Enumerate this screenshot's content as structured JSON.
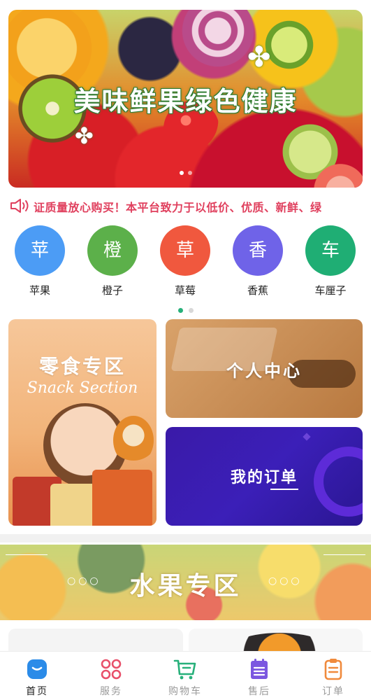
{
  "banner": {
    "title": "美味鲜果绿色健康",
    "slide_count": 2,
    "active_slide": 1
  },
  "notice": {
    "icon": "speaker-icon",
    "text": "证质量放心购买！本平台致力于以低价、优质、新鲜、绿"
  },
  "categories": [
    {
      "char": "苹",
      "label": "苹果",
      "color": "#4c9cf5"
    },
    {
      "char": "橙",
      "label": "橙子",
      "color": "#5cb04a"
    },
    {
      "char": "草",
      "label": "草莓",
      "color": "#f0583e"
    },
    {
      "char": "香",
      "label": "香蕉",
      "color": "#6f63e8"
    },
    {
      "char": "车",
      "label": "车厘子",
      "color": "#1fae74"
    }
  ],
  "category_pager": {
    "pages": 2,
    "active": 1,
    "active_color": "#27b07a"
  },
  "promos": {
    "snack_title": "零食专区",
    "snack_subtitle": "Snack Section",
    "personal_title": "个人中心",
    "order_title": "我的订单"
  },
  "fruit_section": {
    "title": "水果专区",
    "dots_left": "○○○",
    "dots_right": "○○○"
  },
  "tabbar": {
    "items": [
      {
        "label": "首页",
        "icon": "home-icon",
        "color": "#2b8be8",
        "active": true
      },
      {
        "label": "服务",
        "icon": "clover-grid-icon",
        "color": "#e8506a",
        "active": false
      },
      {
        "label": "购物车",
        "icon": "shopping-cart-icon",
        "color": "#27b07a",
        "active": false
      },
      {
        "label": "售后",
        "icon": "calendar-icon",
        "color": "#7b57e0",
        "active": false
      },
      {
        "label": "订单",
        "icon": "clipboard-icon",
        "color": "#f08a3c",
        "active": false
      }
    ]
  }
}
